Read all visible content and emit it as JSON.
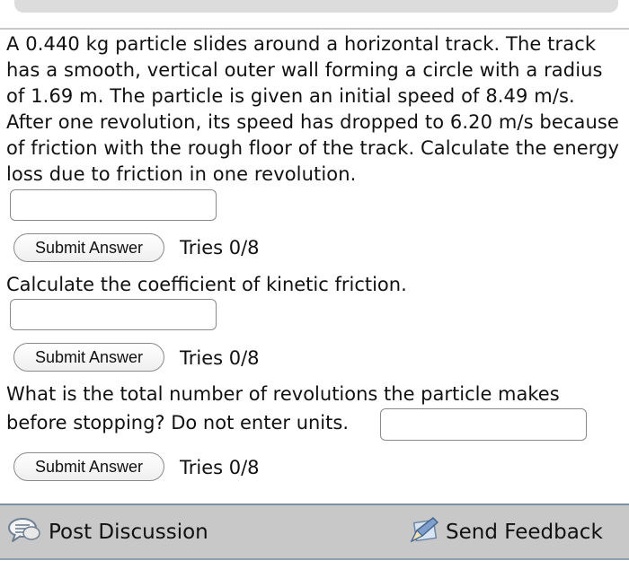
{
  "question1": {
    "text": "A 0.440 kg particle slides around a horizontal track. The track has a smooth, vertical outer wall forming a circle with a radius of 1.69 m. The particle is given an initial speed of 8.49 m/s. After one revolution, its speed has dropped to 6.20 m/s because of friction with the rough floor of the track. Calculate the energy loss due to friction in one revolution.",
    "answer_value": "",
    "submit_label": "Submit Answer",
    "tries": "Tries 0/8"
  },
  "question2": {
    "text": "Calculate the coefficient of kinetic friction.",
    "answer_value": "",
    "submit_label": "Submit Answer",
    "tries": "Tries 0/8"
  },
  "question3": {
    "line1": "What is the total number of revolutions the particle makes",
    "line2": "before stopping? Do not enter units.",
    "answer_value": "",
    "submit_label": "Submit Answer",
    "tries": "Tries 0/8"
  },
  "footer": {
    "post_discussion": "Post Discussion",
    "send_feedback": "Send Feedback",
    "discussion_icon": "speech-bubble-icon",
    "feedback_icon": "pencil-edit-icon"
  }
}
